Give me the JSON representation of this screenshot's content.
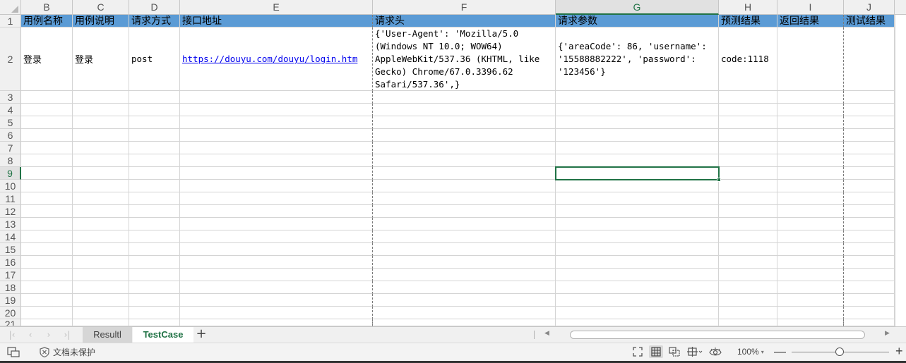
{
  "columns": [
    "B",
    "C",
    "D",
    "E",
    "F",
    "G",
    "H",
    "I",
    "J"
  ],
  "selected_column": "G",
  "rows": [
    "1",
    "2",
    "3",
    "4",
    "5",
    "6",
    "7",
    "8",
    "9",
    "10",
    "11",
    "12",
    "13",
    "14",
    "15",
    "16",
    "17",
    "18",
    "19",
    "20",
    "21"
  ],
  "selected_row": "9",
  "header_row": [
    "用例名称",
    "用例说明",
    "请求方式",
    "接口地址",
    "请求头",
    "请求参数",
    "预测结果",
    "返回结果",
    "测试结果"
  ],
  "data_row": {
    "name": "登录",
    "desc": "登录",
    "method": "post",
    "url": "https://douyu.com/douyu/login.htm",
    "headers": "{'User-Agent': 'Mozilla/5.0\n(Windows NT 10.0; WOW64)\nAppleWebKit/537.36 (KHTML, like\nGecko) Chrome/67.0.3396.62\nSafari/537.36',}",
    "params": "{'areaCode': 86, 'username':\n'15588882222', 'password':\n'123456'}",
    "expected": "code:1118",
    "returned": "",
    "test_result": ""
  },
  "sheet_tabs": [
    "Resultl",
    "TestCase"
  ],
  "active_sheet": "TestCase",
  "status": {
    "protection": "文档未保护",
    "zoom": "100%"
  },
  "icons": {
    "status_left": "sheet-view-icon",
    "protection": "shield-icon",
    "fullscreen": "fullscreen-icon",
    "normal_view": "grid-view-icon",
    "page_break": "page-break-view-icon",
    "layout": "page-layout-icon",
    "eye": "reading-mode-icon"
  },
  "colors": {
    "header_fill": "#5b9bd5",
    "accent": "#217346",
    "link": "#0000ee"
  }
}
